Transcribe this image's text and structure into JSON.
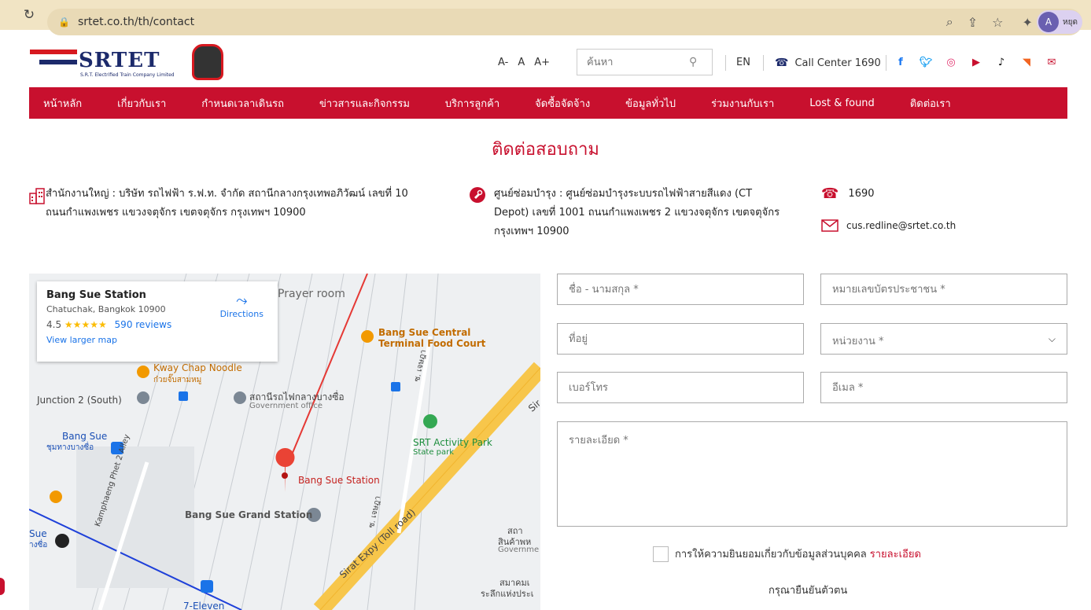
{
  "browser": {
    "url": "srtet.co.th/th/contact",
    "profile_initial": "A",
    "profile_label": "หยุด"
  },
  "header": {
    "logo_text": "SRTET",
    "logo_subtitle": "S.R.T. Electrified Train Company Limited",
    "font_small": "A-",
    "font_normal": "A",
    "font_large": "A+",
    "search_placeholder": "ค้นหา",
    "lang": "EN",
    "call_center": "Call Center 1690",
    "social_icons": [
      "facebook-icon",
      "twitter-icon",
      "instagram-icon",
      "youtube-icon",
      "tiktok-icon",
      "rss-icon",
      "mail-icon"
    ]
  },
  "nav": {
    "items": [
      "หน้าหลัก",
      "เกี่ยวกับเรา",
      "กำหนดเวลาเดินรถ",
      "ข่าวสารและกิจกรรม",
      "บริการลูกค้า",
      "จัดซื้อจัดจ้าง",
      "ข้อมูลทั่วไป",
      "ร่วมงานกับเรา",
      "Lost & found",
      "ติดต่อเรา"
    ]
  },
  "page_title": "ติดต่อสอบถาม",
  "contact": {
    "hq_line1": "สำนักงานใหญ่ : บริษัท รถไฟฟ้า ร.ฟ.ท. จำกัด สถานีกลางกรุงเทพอภิวัฒน์ เลขที่ 10",
    "hq_line2": "ถนนกำแพงเพชร แขวงจตุจักร เขตจตุจักร กรุงเทพฯ 10900",
    "depot_line1": "ศูนย์ซ่อมบำรุง : ศูนย์ซ่อมบำรุงระบบรถไฟฟ้าสายสีแดง (CT",
    "depot_line2": "Depot) เลขที่ 1001 ถนนกำแพงเพชร 2 แขวงจตุจักร เขตจตุจักร",
    "depot_line3": "กรุงเทพฯ 10900",
    "phone": "1690",
    "email": "cus.redline@srtet.co.th"
  },
  "map": {
    "place_name": "Bang Sue Station",
    "place_address": "Chatuchak, Bangkok 10900",
    "rating": "4.5",
    "stars": "★★★★★",
    "reviews": "590 reviews",
    "larger_map": "View larger map",
    "directions": "Directions",
    "labels": {
      "prayer": "Prayer room",
      "food_court_1": "Bang Sue Central",
      "food_court_2": "Terminal Food Court",
      "noodle": "Kway Chap Noodle",
      "noodle_th": "ก๋วยจั๊บสามหมู",
      "junction": "Junction 2 (South)",
      "central_station_th": "สถานีรถไฟกลางบางซื่อ",
      "gov_office": "Government office",
      "bangsue_1": "Bang Sue",
      "bangsue_th": "ชุมทางบางซื่อ",
      "activity_park": "SRT Activity Park",
      "state_park": "State park",
      "station_pin": "Bang Sue Station",
      "grand_station": "Bang Sue Grand Station",
      "kamphaeng": "Kamphaeng Phet 2 Alley",
      "sirat": "Sirat Expy (Toll road)",
      "sue_left": "Sue",
      "sue_left_th": "างซื่อ",
      "seven": "7-Eleven",
      "right_1": "สถา",
      "right_2": "สินค้าพห",
      "right_3": "Governme",
      "right_4": "สมาคมเ",
      "right_5": "ระลึกแห่งประเ",
      "soi_1": "ซ. เจษฎา",
      "soi_2": "ซ. เจษฎา",
      "sir": "Sir"
    }
  },
  "form": {
    "name_placeholder": "ชื่อ - นามสกุล *",
    "id_placeholder": "หมายเลขบัตรประชาชน *",
    "address_placeholder": "ที่อยู่",
    "agency_placeholder": "หน่วยงาน *",
    "phone_placeholder": "เบอร์โทร",
    "email_placeholder": "อีเมล *",
    "detail_placeholder": "รายละเอียด *",
    "consent_text": "การให้ความยินยอมเกี่ยวกับข้อมูลส่วนบุคคล",
    "consent_link": "รายละเอียด",
    "verify_text": "กรุณายืนยันตัวตน"
  },
  "colors": {
    "brand_red": "#c8102e",
    "brand_navy": "#1c2a6b"
  }
}
